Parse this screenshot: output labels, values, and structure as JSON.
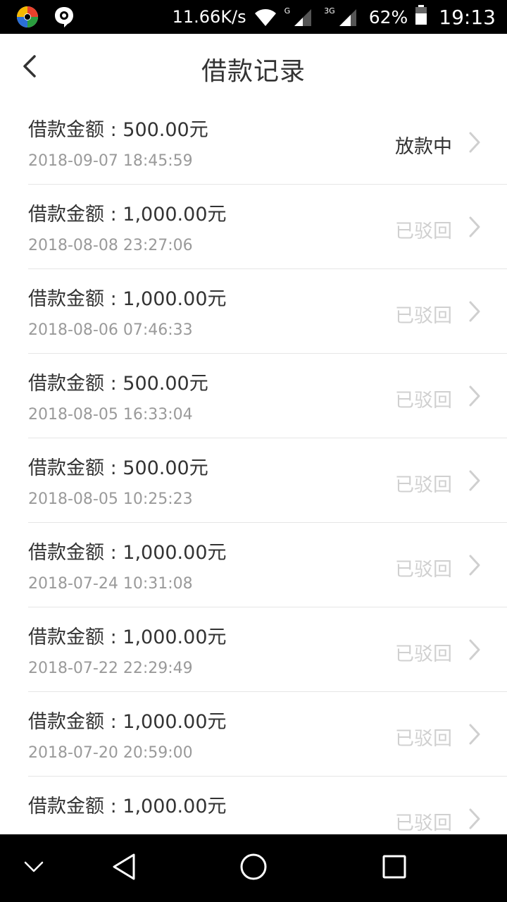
{
  "status_bar": {
    "net_speed": "11.66K/s",
    "net_label_1": "G",
    "net_label_2": "3G",
    "battery": "62%",
    "time": "19:13"
  },
  "header": {
    "title": "借款记录"
  },
  "records": [
    {
      "amount": "借款金额 : 500.00元",
      "time": "2018-09-07 18:45:59",
      "status": "放款中"
    },
    {
      "amount": "借款金额 : 1,000.00元",
      "time": "2018-08-08 23:27:06",
      "status": "已驳回"
    },
    {
      "amount": "借款金额 : 1,000.00元",
      "time": "2018-08-06 07:46:33",
      "status": "已驳回"
    },
    {
      "amount": "借款金额 : 500.00元",
      "time": "2018-08-05 16:33:04",
      "status": "已驳回"
    },
    {
      "amount": "借款金额 : 500.00元",
      "time": "2018-08-05 10:25:23",
      "status": "已驳回"
    },
    {
      "amount": "借款金额 : 1,000.00元",
      "time": "2018-07-24 10:31:08",
      "status": "已驳回"
    },
    {
      "amount": "借款金额 : 1,000.00元",
      "time": "2018-07-22 22:29:49",
      "status": "已驳回"
    },
    {
      "amount": "借款金额 : 1,000.00元",
      "time": "2018-07-20 20:59:00",
      "status": "已驳回"
    },
    {
      "amount": "借款金额 : 1,000.00元",
      "time": "",
      "status": "已驳回"
    }
  ],
  "colors": {
    "status_active": "#333333",
    "status_rejected": "#d0d0d0",
    "timestamp": "#9a9a9a"
  }
}
